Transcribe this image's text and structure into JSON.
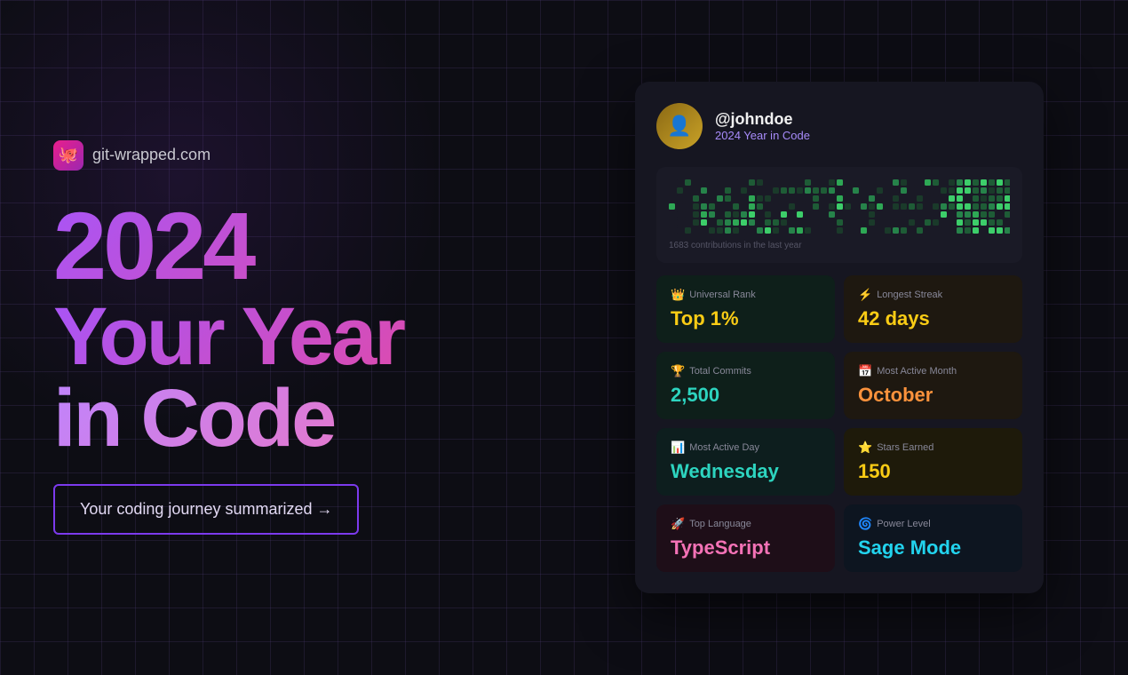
{
  "brand": {
    "name": "git-wrapped.com",
    "icon": "🐙"
  },
  "hero": {
    "year": "2024",
    "line1": "Your Year",
    "line2": "in Code",
    "cta": "Your coding journey summarized →"
  },
  "card": {
    "username": "@johndoe",
    "year_label": "2024 Year in Code",
    "contrib_label": "1683 contributions in the last year",
    "stats": [
      {
        "icon": "👑",
        "label": "Universal Rank",
        "value": "Top 1%",
        "color": "yellow",
        "bg": "dark-green"
      },
      {
        "icon": "⚡",
        "label": "Longest Streak",
        "value": "42 days",
        "color": "yellow",
        "bg": "dark-brown"
      },
      {
        "icon": "🏆",
        "label": "Total Commits",
        "value": "2,500",
        "color": "teal",
        "bg": "dark-green"
      },
      {
        "icon": "📅",
        "label": "Most Active Month",
        "value": "October",
        "color": "orange",
        "bg": "dark-brown"
      },
      {
        "icon": "📊",
        "label": "Most Active Day",
        "value": "Wednesday",
        "color": "teal",
        "bg": "dark-teal"
      },
      {
        "icon": "⭐",
        "label": "Stars Earned",
        "value": "150",
        "color": "yellow",
        "bg": "dark-gold"
      },
      {
        "icon": "🚀",
        "label": "Top Language",
        "value": "TypeScript",
        "color": "pink",
        "bg": "dark-pink"
      },
      {
        "icon": "🌀",
        "label": "Power Level",
        "value": "Sage Mode",
        "color": "cyan",
        "bg": "dark-blue"
      }
    ]
  }
}
